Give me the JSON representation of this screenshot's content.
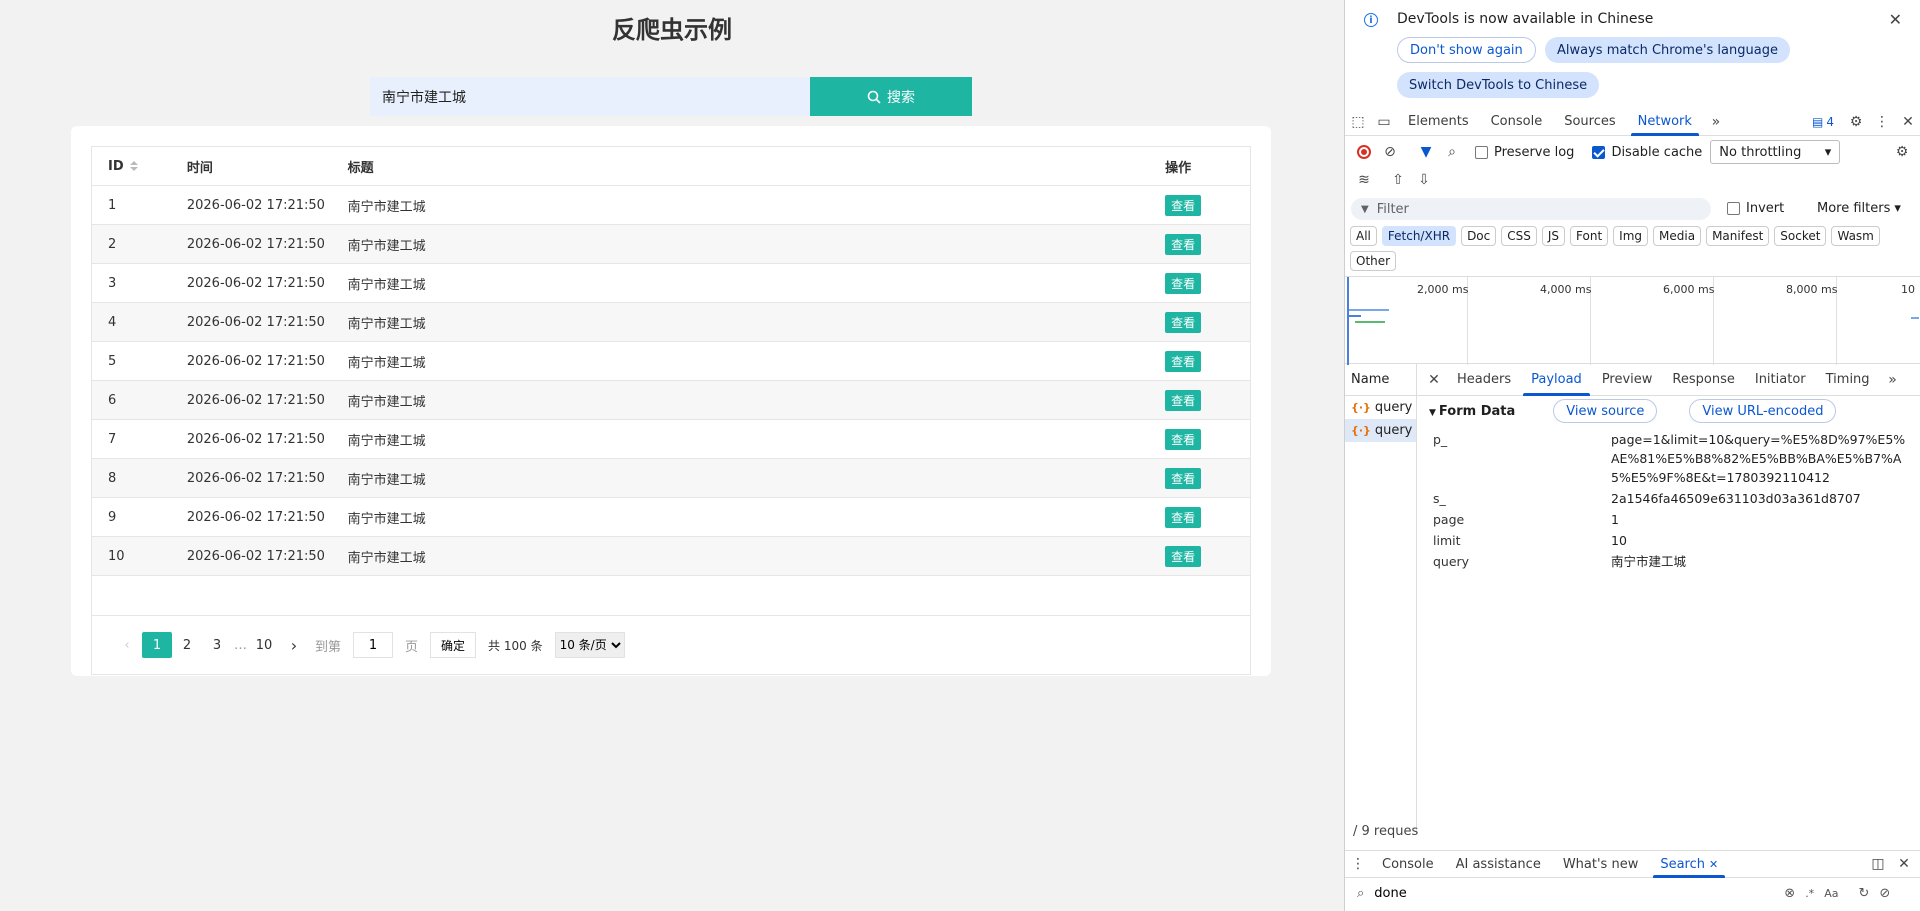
{
  "page": {
    "title": "反爬虫示例",
    "search": {
      "value": "南宁市建工城",
      "button_label": "搜索"
    },
    "table": {
      "headers": [
        "ID",
        "时间",
        "标题",
        "操作"
      ],
      "rows": [
        {
          "id": "1",
          "time": "2026-06-02 17:21:50",
          "title": "南宁市建工城",
          "action": "查看"
        },
        {
          "id": "2",
          "time": "2026-06-02 17:21:50",
          "title": "南宁市建工城",
          "action": "查看"
        },
        {
          "id": "3",
          "time": "2026-06-02 17:21:50",
          "title": "南宁市建工城",
          "action": "查看"
        },
        {
          "id": "4",
          "time": "2026-06-02 17:21:50",
          "title": "南宁市建工城",
          "action": "查看"
        },
        {
          "id": "5",
          "time": "2026-06-02 17:21:50",
          "title": "南宁市建工城",
          "action": "查看"
        },
        {
          "id": "6",
          "time": "2026-06-02 17:21:50",
          "title": "南宁市建工城",
          "action": "查看"
        },
        {
          "id": "7",
          "time": "2026-06-02 17:21:50",
          "title": "南宁市建工城",
          "action": "查看"
        },
        {
          "id": "8",
          "time": "2026-06-02 17:21:50",
          "title": "南宁市建工城",
          "action": "查看"
        },
        {
          "id": "9",
          "time": "2026-06-02 17:21:50",
          "title": "南宁市建工城",
          "action": "查看"
        },
        {
          "id": "10",
          "time": "2026-06-02 17:21:50",
          "title": "南宁市建工城",
          "action": "查看"
        }
      ]
    },
    "pagination": {
      "pages": [
        "1",
        "2",
        "3"
      ],
      "ellipsis": "…",
      "last": "10",
      "goto_label": "到第",
      "goto_value": "1",
      "page_unit": "页",
      "confirm_label": "确定",
      "total_label": "共 100 条",
      "page_size": "10 条/页"
    }
  },
  "devtools": {
    "infobar": {
      "message": "DevTools is now available in Chinese",
      "dont_show": "Don't show again",
      "always_match": "Always match Chrome's language",
      "switch": "Switch DevTools to Chinese"
    },
    "tabs": [
      "Elements",
      "Console",
      "Sources",
      "Network"
    ],
    "active_tab": "Network",
    "issue_count": "4",
    "toolbar": {
      "preserve_log": "Preserve log",
      "disable_cache": "Disable cache",
      "throttling": "No throttling"
    },
    "filter": {
      "placeholder": "Filter",
      "invert": "Invert",
      "more_filters": "More filters"
    },
    "types": [
      "All",
      "Fetch/XHR",
      "Doc",
      "CSS",
      "JS",
      "Font",
      "Img",
      "Media",
      "Manifest",
      "Socket",
      "Wasm",
      "Other"
    ],
    "active_type": "Fetch/XHR",
    "timeline_labels": [
      "2,000 ms",
      "4,000 ms",
      "6,000 ms",
      "8,000 ms",
      "10"
    ],
    "name_header": "Name",
    "requests": [
      "query",
      "query"
    ],
    "detail_tabs": [
      "Headers",
      "Payload",
      "Preview",
      "Response",
      "Initiator",
      "Timing"
    ],
    "active_detail_tab": "Payload",
    "form_data": {
      "title": "Form Data",
      "view_source": "View source",
      "view_url_encoded": "View URL-encoded",
      "fields": [
        {
          "key": "p_",
          "value": "page=1&limit=10&query=%E5%8D%97%E5%AE%81%E5%B8%82%E5%BB%BA%E5%B7%A5%E5%9F%8E&t=1780392110412"
        },
        {
          "key": "s_",
          "value": "2a1546fa46509e631103d03a361d8707"
        },
        {
          "key": "page",
          "value": "1"
        },
        {
          "key": "limit",
          "value": "10"
        },
        {
          "key": "query",
          "value": "南宁市建工城"
        }
      ]
    },
    "status": "/ 9 reques",
    "drawer_tabs": [
      "Console",
      "AI assistance",
      "What's new",
      "Search"
    ],
    "active_drawer_tab": "Search",
    "search_query": "done",
    "search_options": ".*",
    "search_case": "Aa"
  }
}
